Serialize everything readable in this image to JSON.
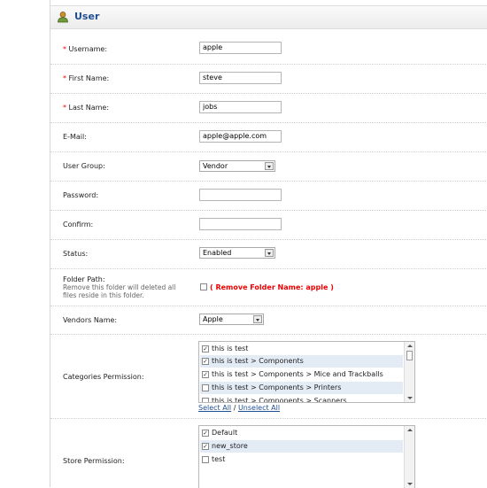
{
  "header": {
    "title": "User",
    "icon": "user-icon"
  },
  "form": {
    "username": {
      "required": "*",
      "label": "Username:",
      "value": "apple"
    },
    "first_name": {
      "required": "*",
      "label": "First Name:",
      "value": "steve"
    },
    "last_name": {
      "required": "*",
      "label": "Last Name:",
      "value": "jobs"
    },
    "email": {
      "label": "E-Mail:",
      "value": "apple@apple.com"
    },
    "user_group": {
      "label": "User Group:",
      "value": "Vendor"
    },
    "password": {
      "label": "Password:",
      "value": ""
    },
    "confirm": {
      "label": "Confirm:",
      "value": ""
    },
    "status": {
      "label": "Status:",
      "value": "Enabled"
    },
    "folder_path": {
      "label": "Folder Path:",
      "hint_line1": "Remove this folder will deleted all",
      "hint_line2": "files reside in this folder.",
      "remove_label": "( Remove Folder Name: apple )"
    },
    "vendors_name": {
      "label": "Vendors Name:",
      "value": "Apple"
    },
    "categories_permission": {
      "label": "Categories Permission:",
      "items": [
        {
          "label": "this is test",
          "checked": true
        },
        {
          "label": "this is test > Components",
          "checked": true
        },
        {
          "label": "this is test > Components > Mice and Trackballs",
          "checked": true
        },
        {
          "label": "this is test > Components > Printers",
          "checked": false
        },
        {
          "label": "this is test > Components > Scanners",
          "checked": false
        }
      ],
      "select_all": "Select All",
      "separator": "/",
      "unselect_all": "Unselect All"
    },
    "store_permission": {
      "label": "Store Permission:",
      "items": [
        {
          "label": "Default",
          "checked": true
        },
        {
          "label": "new_store",
          "checked": true
        },
        {
          "label": "test",
          "checked": false
        }
      ]
    }
  },
  "colors": {
    "title": "#1f4f93",
    "required": "#e00000",
    "row_highlight": "#e3ebf5"
  }
}
